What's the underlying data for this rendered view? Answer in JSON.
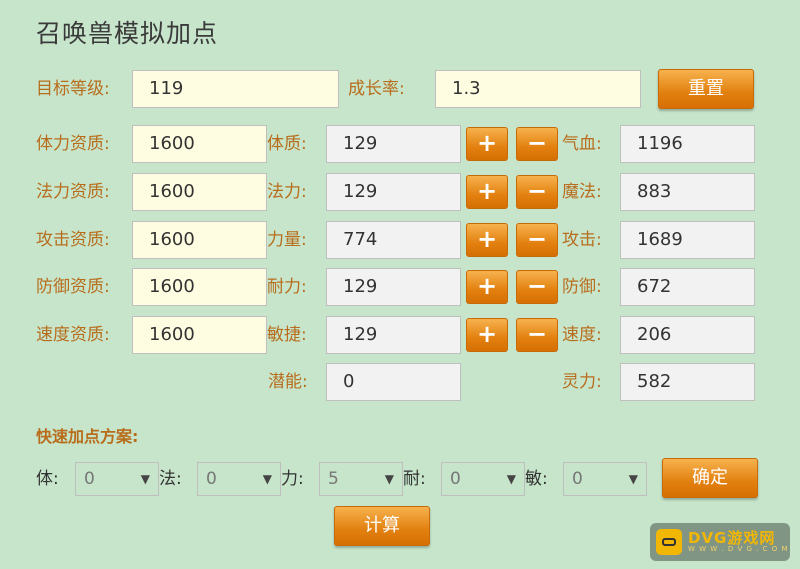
{
  "title": "召唤兽模拟加点",
  "top": {
    "level_label": "目标等级:",
    "level_value": "119",
    "growth_label": "成长率:",
    "growth_value": "1.3",
    "reset_label": "重置"
  },
  "rows": [
    {
      "apt_label": "体力资质:",
      "apt_value": "1600",
      "stat_label": "体质:",
      "stat_value": "129",
      "res_label": "气血:",
      "res_value": "1196"
    },
    {
      "apt_label": "法力资质:",
      "apt_value": "1600",
      "stat_label": "法力:",
      "stat_value": "129",
      "res_label": "魔法:",
      "res_value": "883"
    },
    {
      "apt_label": "攻击资质:",
      "apt_value": "1600",
      "stat_label": "力量:",
      "stat_value": "774",
      "res_label": "攻击:",
      "res_value": "1689"
    },
    {
      "apt_label": "防御资质:",
      "apt_value": "1600",
      "stat_label": "耐力:",
      "stat_value": "129",
      "res_label": "防御:",
      "res_value": "672"
    },
    {
      "apt_label": "速度资质:",
      "apt_value": "1600",
      "stat_label": "敏捷:",
      "stat_value": "129",
      "res_label": "速度:",
      "res_value": "206"
    }
  ],
  "plus": "+",
  "minus": "−",
  "potential": {
    "label": "潜能:",
    "value": "0"
  },
  "spirit": {
    "label": "灵力:",
    "value": "582"
  },
  "quick": {
    "title": "快速加点方案:",
    "selects": [
      {
        "label": "体:",
        "value": "0"
      },
      {
        "label": "法:",
        "value": "0"
      },
      {
        "label": "力:",
        "value": "5"
      },
      {
        "label": "耐:",
        "value": "0"
      },
      {
        "label": "敏:",
        "value": "0"
      }
    ],
    "confirm_label": "确定",
    "calc_label": "计算"
  },
  "watermark": {
    "brand": "DVG游戏网",
    "sub": "W W W . D V G . C O M"
  }
}
